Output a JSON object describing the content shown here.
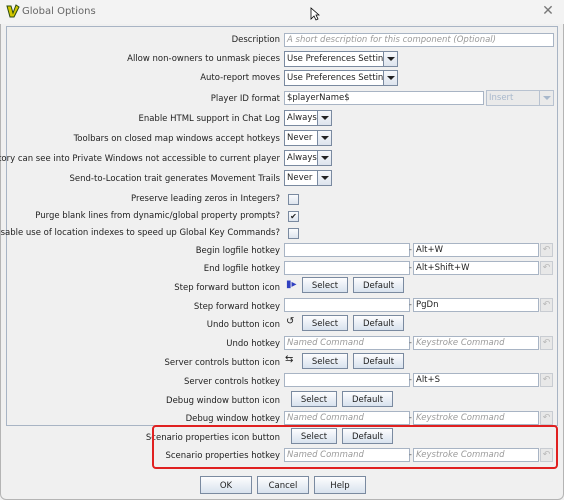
{
  "window": {
    "title": "Global Options",
    "close_icon": "close-icon",
    "app_icon": "vassal-logo-icon"
  },
  "rows": {
    "description": {
      "label": "Description",
      "placeholder": "A short description for this component (Optional)"
    },
    "unmask": {
      "label": "Allow non-owners to unmask pieces",
      "value": "Use Preferences Setting"
    },
    "autoreport": {
      "label": "Auto-report moves",
      "value": "Use Preferences Setting"
    },
    "playerid": {
      "label": "Player ID format",
      "value": "$playerName$",
      "insert": "Insert"
    },
    "html": {
      "label": "Enable HTML support in Chat Log",
      "value": "Always"
    },
    "toolbars": {
      "label": "Toolbars on closed map windows accept hotkeys",
      "value": "Never"
    },
    "inventory": {
      "label": "Inventory can see into Private Windows not accessible to current player",
      "value": "Always"
    },
    "sendto": {
      "label": "Send-to-Location trait generates Movement Trails",
      "value": "Never"
    },
    "zeros": {
      "label": "Preserve leading zeros in Integers?",
      "checked": false
    },
    "purge": {
      "label": "Purge blank lines from dynamic/global property prompts?",
      "checked": true,
      "check_glyph": "✔"
    },
    "indexes": {
      "label": "Disable use of location indexes to speed up Global Key Commands?",
      "checked": false
    },
    "beginlog": {
      "label": "Begin logfile hotkey",
      "named": "",
      "keystroke": "Alt+W"
    },
    "endlog": {
      "label": "End logfile hotkey",
      "keystroke": "Alt+Shift+W",
      "named": ""
    },
    "stepicon": {
      "label": "Step forward button icon"
    },
    "stephotkey": {
      "label": "Step forward hotkey",
      "named": "",
      "keystroke": "PgDn"
    },
    "undoicon": {
      "label": "Undo button icon"
    },
    "undohotkey": {
      "label": "Undo hotkey",
      "named_placeholder": "Named Command",
      "keystroke_placeholder": "Keystroke Command"
    },
    "servericon": {
      "label": "Server controls button icon"
    },
    "serverhotkey": {
      "label": "Server controls hotkey",
      "named": "",
      "keystroke": "Alt+S"
    },
    "debugicon": {
      "label": "Debug window button icon"
    },
    "debughotkey": {
      "label": "Debug window hotkey",
      "named_placeholder": "Named Command",
      "keystroke_placeholder": "Keystroke Command"
    },
    "scenarioicon": {
      "label": "Scenario properties icon button"
    },
    "scenariohotkey": {
      "label": "Scenario properties hotkey",
      "named_placeholder": "Named Command",
      "keystroke_placeholder": "Keystroke Command"
    }
  },
  "buttons": {
    "select": "Select",
    "default": "Default",
    "ok": "OK",
    "cancel": "Cancel",
    "help": "Help",
    "dash": "-",
    "undo_glyph": "↶"
  },
  "colors": {
    "highlight": "#e02020",
    "border": "#a8b4c4"
  }
}
